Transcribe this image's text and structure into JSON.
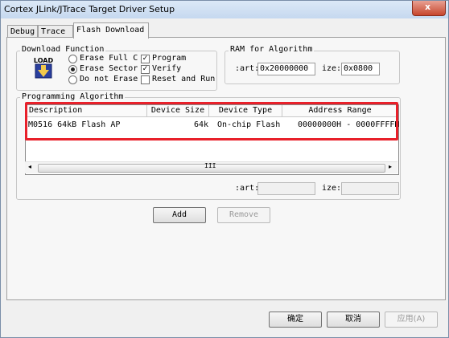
{
  "window": {
    "title": "Cortex JLink/JTrace Target Driver Setup"
  },
  "tabs": [
    {
      "label": "Debug",
      "active": false
    },
    {
      "label": "Trace",
      "active": false
    },
    {
      "label": "Flash Download",
      "active": true
    }
  ],
  "download_function": {
    "legend": "Download Function",
    "icon_text": "LOAD",
    "radios": [
      {
        "label": "Erase Full C",
        "checked": false
      },
      {
        "label": "Erase Sector",
        "checked": true
      },
      {
        "label": "Do not Erase",
        "checked": false
      }
    ],
    "checkboxes": [
      {
        "label": "Program",
        "checked": true
      },
      {
        "label": "Verify",
        "checked": true
      },
      {
        "label": "Reset and Run",
        "checked": false
      }
    ]
  },
  "ram": {
    "legend": "RAM for Algorithm",
    "start_label": ":art:",
    "start_value": "0x20000000",
    "size_label": "ize:",
    "size_value": "0x0800"
  },
  "programming_algorithm": {
    "legend": "Programming Algorithm",
    "columns": [
      "Description",
      "Device Size",
      "Device Type",
      "Address Range"
    ],
    "rows": [
      {
        "description": "M0516 64kB Flash AP",
        "device_size": "64k",
        "device_type": "On-chip Flash",
        "address_range": "00000000H - 0000FFFFH"
      }
    ],
    "scroll_grip": "III",
    "start_label": ":art:",
    "start_value": "",
    "size_label": "ize:",
    "size_value": ""
  },
  "buttons": {
    "add": "Add",
    "remove": "Remove",
    "ok": "确定",
    "cancel": "取消",
    "apply": "应用(A)"
  },
  "colors": {
    "highlight": "#e8202a"
  }
}
